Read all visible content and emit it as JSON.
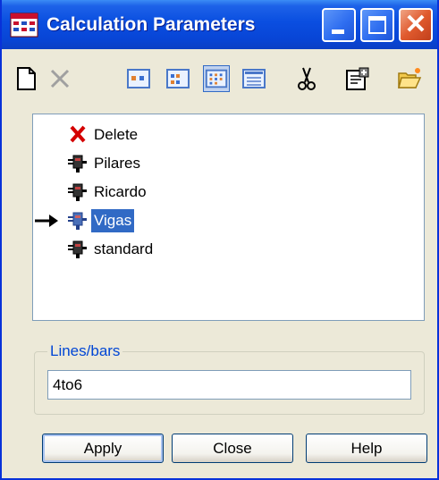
{
  "window": {
    "title": "Calculation Parameters"
  },
  "toolbar": {
    "tools": [
      {
        "name": "new-document-icon"
      },
      {
        "name": "delete-x-icon"
      },
      {
        "name": "view-large-icons-icon"
      },
      {
        "name": "view-small-icons-icon"
      },
      {
        "name": "view-list-icon",
        "pressed": true
      },
      {
        "name": "view-details-icon"
      },
      {
        "name": "cut-scissors-icon"
      },
      {
        "name": "properties-icon"
      },
      {
        "name": "open-folder-icon"
      }
    ]
  },
  "tree": {
    "items": [
      {
        "label": "Delete",
        "icon": "red-x-icon",
        "selected": false,
        "current": false
      },
      {
        "label": "Pilares",
        "icon": "plug-icon",
        "selected": false,
        "current": false
      },
      {
        "label": "Ricardo",
        "icon": "plug-icon",
        "selected": false,
        "current": false
      },
      {
        "label": "Vigas",
        "icon": "plug-icon",
        "selected": true,
        "current": true
      },
      {
        "label": "standard",
        "icon": "plug-icon",
        "selected": false,
        "current": false
      }
    ]
  },
  "lines_bars": {
    "label": "Lines/bars",
    "value": "4to6"
  },
  "buttons": {
    "apply": "Apply",
    "close": "Close",
    "help": "Help"
  },
  "colors": {
    "titlebar": "#0a4ee0",
    "selection": "#316ac5",
    "group_label": "#0046d5"
  }
}
